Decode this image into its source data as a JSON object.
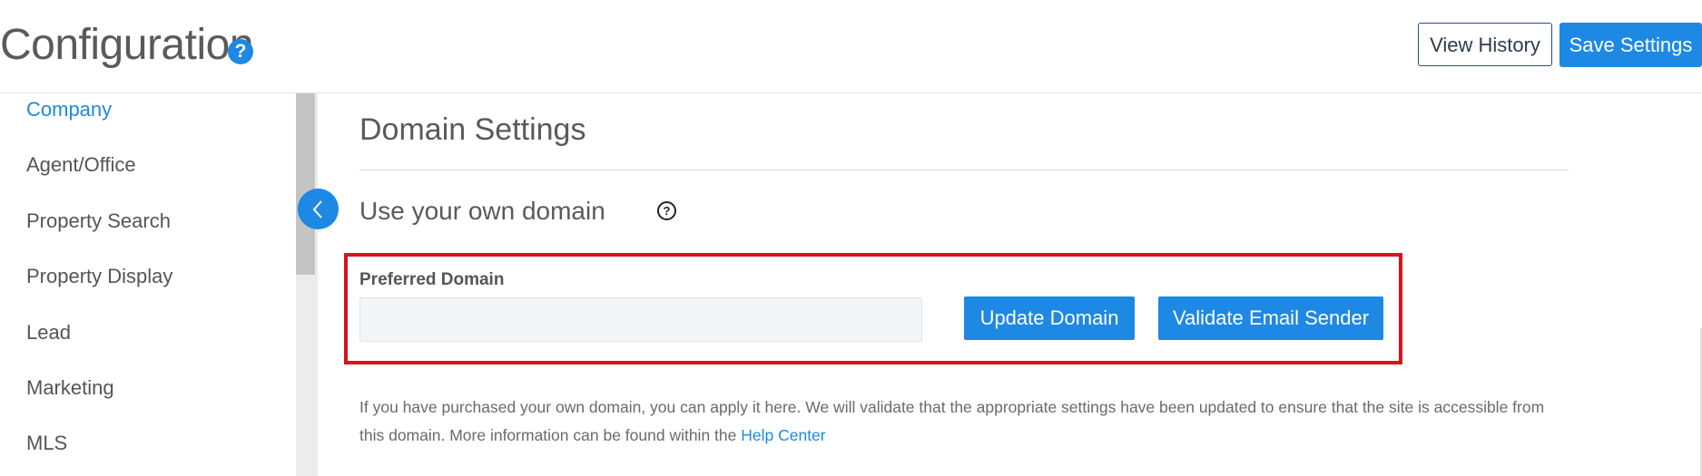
{
  "header": {
    "title": "Configuration",
    "help_badge": "?",
    "view_history_label": "View History",
    "save_settings_label": "Save Settings"
  },
  "sidebar": {
    "items": [
      {
        "label": "Company",
        "active": true
      },
      {
        "label": "Agent/Office",
        "active": false
      },
      {
        "label": "Property Search",
        "active": false
      },
      {
        "label": "Property Display",
        "active": false
      },
      {
        "label": "Lead",
        "active": false
      },
      {
        "label": "Marketing",
        "active": false
      },
      {
        "label": "MLS",
        "active": false
      }
    ],
    "collapse_icon": "chevron-left-icon"
  },
  "main": {
    "section_title": "Domain Settings",
    "subsection_title": "Use your own domain",
    "subsection_help": "?",
    "preferred_domain_label": "Preferred Domain",
    "preferred_domain_value": "",
    "update_domain_label": "Update Domain",
    "validate_email_label": "Validate Email Sender",
    "help_text": "If you have purchased your own domain, you can apply it here. We will validate that the appropriate settings have been updated to ensure that the site is accessible from this domain. More information can be found within the ",
    "help_link": "Help Center"
  },
  "colors": {
    "accent": "#1e88e5",
    "highlight": "#d9121e",
    "text": "#555555"
  }
}
